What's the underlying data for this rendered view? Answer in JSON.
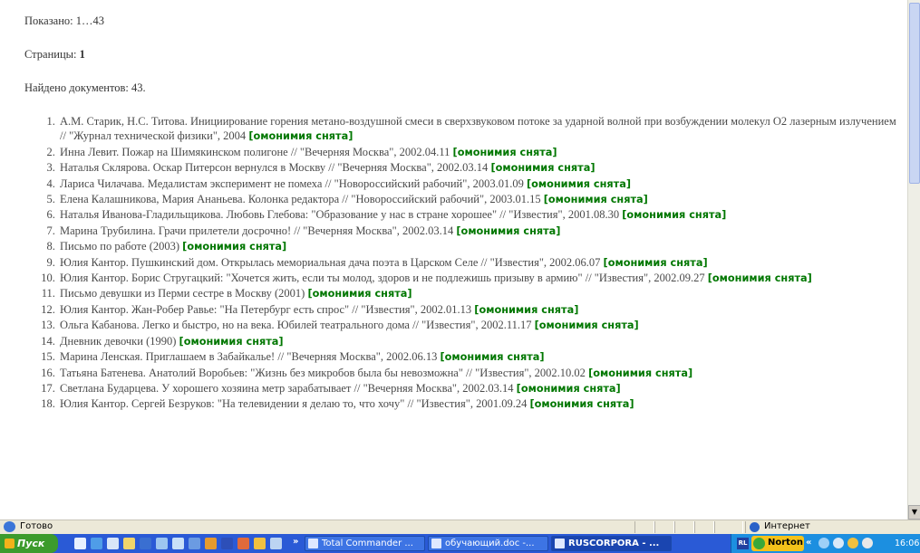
{
  "results": {
    "shown_label": "Показано: 1…43",
    "pages_label": "Страницы: ",
    "pages_current": "1",
    "found_label": "Найдено документов: 43."
  },
  "documents": [
    {
      "n": 1,
      "text": "А.М. Старик, Н.С. Титова. Инициирование горения метано-воздушной смеси в сверхзвуковом потоке за ударной волной при возбуждении молекул O2 лазерным излучением // \"Журнал технической физики\", 2004",
      "flag": "[омонимия снята]"
    },
    {
      "n": 2,
      "text": "Инна Левит. Пожар на Шимякинском полигоне // \"Вечерняя Москва\", 2002.04.11",
      "flag": "[омонимия снята]"
    },
    {
      "n": 3,
      "text": "Наталья Склярова. Оскар Питерсон вернулся в Москву // \"Вечерняя Москва\", 2002.03.14",
      "flag": "[омонимия снята]"
    },
    {
      "n": 4,
      "text": "Лариса Чилачава. Медалистам эксперимент не помеха // \"Новороссийский рабочий\", 2003.01.09",
      "flag": "[омонимия снята]"
    },
    {
      "n": 5,
      "text": "Елена Калашникова, Мария Ананьева. Колонка редактора // \"Новороссийский рабочий\", 2003.01.15",
      "flag": "[омонимия снята]"
    },
    {
      "n": 6,
      "text": "Наталья Иванова-Гладильщикова. Любовь Глебова: \"Образование у нас в стране хорошее\" // \"Известия\", 2001.08.30",
      "flag": "[омонимия снята]"
    },
    {
      "n": 7,
      "text": "Марина Трубилина. Грачи прилетели досрочно! // \"Вечерняя Москва\", 2002.03.14",
      "flag": "[омонимия снята]"
    },
    {
      "n": 8,
      "text": "Письмо по работе (2003)",
      "flag": "[омонимия снята]"
    },
    {
      "n": 9,
      "text": "Юлия Кантор. Пушкинский дом. Открылась мемориальная дача поэта в Царском Селе // \"Известия\", 2002.06.07",
      "flag": "[омонимия снята]"
    },
    {
      "n": 10,
      "text": "Юлия Кантор. Борис Стругацкий: \"Хочется жить, если ты молод, здоров и не подлежишь призыву в армию\" // \"Известия\", 2002.09.27",
      "flag": "[омонимия снята]"
    },
    {
      "n": 11,
      "text": "Письмо девушки из Перми сестре в Москву (2001)",
      "flag": "[омонимия снята]"
    },
    {
      "n": 12,
      "text": "Юлия Кантор. Жан-Робер Равье: \"На Петербург есть спрос\" // \"Известия\", 2002.01.13",
      "flag": "[омонимия снята]"
    },
    {
      "n": 13,
      "text": "Ольга Кабанова. Легко и быстро, но на века. Юбилей театрального дома // \"Известия\", 2002.11.17",
      "flag": "[омонимия снята]"
    },
    {
      "n": 14,
      "text": "Дневник девочки (1990)",
      "flag": "[омонимия снята]"
    },
    {
      "n": 15,
      "text": "Марина Ленская. Приглашаем в Забайкалье! // \"Вечерняя Москва\", 2002.06.13",
      "flag": "[омонимия снята]"
    },
    {
      "n": 16,
      "text": "Татьяна Батенева. Анатолий Воробьев: \"Жизнь без микробов была бы невозможна\" // \"Известия\", 2002.10.02",
      "flag": "[омонимия снята]"
    },
    {
      "n": 17,
      "text": "Светлана Бударцева. У хорошего хозяина метр зарабатывает // \"Вечерняя Москва\", 2002.03.14",
      "flag": "[омонимия снята]"
    },
    {
      "n": 18,
      "text": "Юлия Кантор. Сергей Безруков: \"На телевидении я делаю то, что хочу\" // \"Известия\", 2001.09.24",
      "flag": "[омонимия снята]"
    }
  ],
  "statusbar": {
    "status": "Готово",
    "zone": "Интернет"
  },
  "taskbar": {
    "start_label": "Пуск",
    "more_label": "»",
    "tasks": [
      {
        "label": "Total Commander ...",
        "icon": "total-commander-icon"
      },
      {
        "label": "обучающий.doc -...",
        "icon": "word-document-icon"
      },
      {
        "label": "RUSCORPORA - ...",
        "icon": "internet-explorer-icon"
      }
    ],
    "tray": {
      "rl_label": "RL",
      "norton_label": "Norton",
      "chevron": "«",
      "clock": "16:06"
    }
  },
  "colors": {
    "flag": "#007700",
    "text": "#4a4a4a",
    "taskbar": "#2a5ad6",
    "start": "#3c9b2c",
    "tray": "#1c8fe0"
  }
}
